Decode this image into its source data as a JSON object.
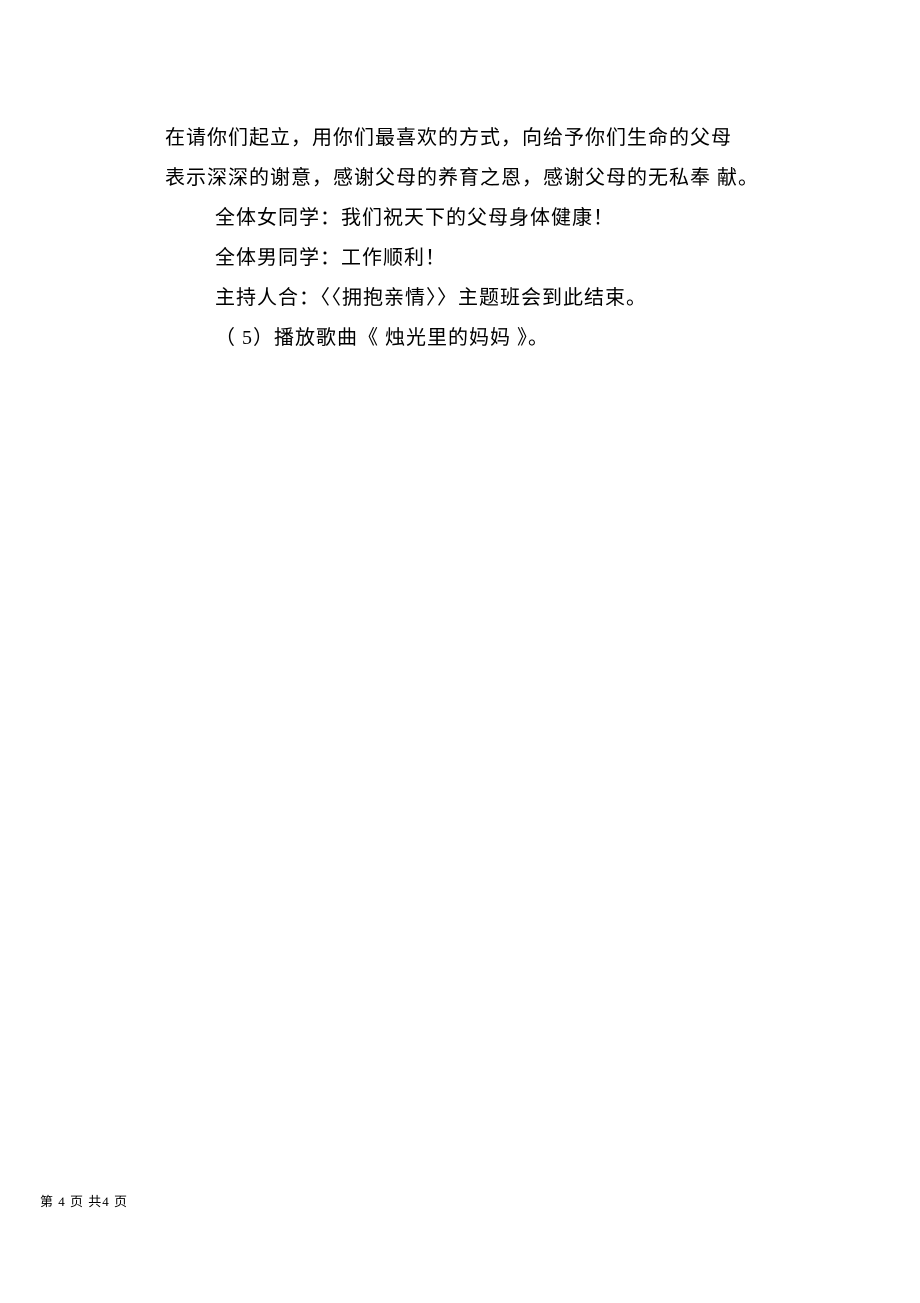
{
  "paragraphs": [
    {
      "text": "在请你们起立，用你们最喜欢的方式，向给予你们生命的父母",
      "indent": false
    },
    {
      "text": "表示深深的谢意，感谢父母的养育之恩，感谢父母的无私奉 献。",
      "indent": false
    },
    {
      "text": "全体女同学：我们祝天下的父母身体健康！",
      "indent": true
    },
    {
      "text": "全体男同学：工作顺利！",
      "indent": true
    },
    {
      "text": "主持人合：〈〈拥抱亲情〉〉主题班会到此结束。",
      "indent": true
    },
    {
      "text": "（ 5）播放歌曲《 烛光里的妈妈 》。",
      "indent": true
    }
  ],
  "footer": "第 4 页 共4 页"
}
